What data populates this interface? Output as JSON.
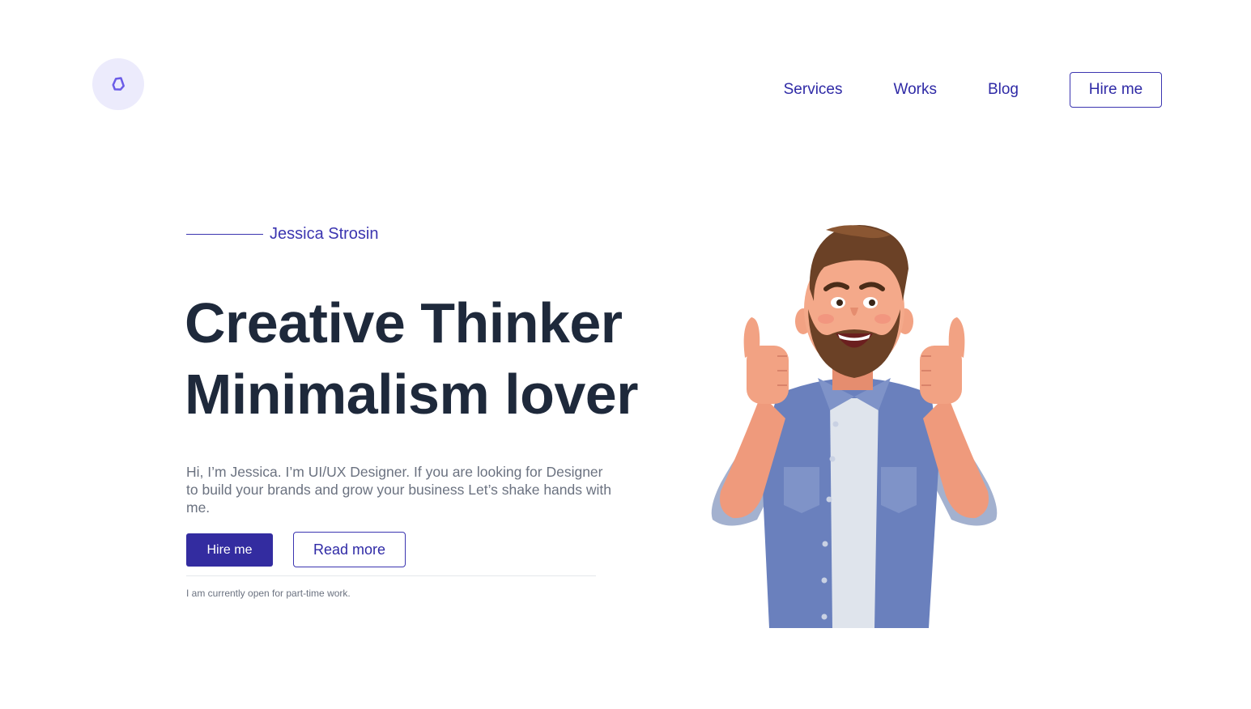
{
  "header": {
    "logo_icon": "droplet-logo-icon",
    "nav": {
      "items": [
        {
          "label": "Services"
        },
        {
          "label": "Works"
        },
        {
          "label": "Blog"
        }
      ],
      "hire_label": "Hire me"
    }
  },
  "hero": {
    "eyebrow": "Jessica Strosin",
    "headline_line1": "Creative Thinker",
    "headline_line2": "Minimalism lover",
    "intro": "Hi, I’m Jessica. I’m UI/UX Designer. If you are looking for Designer to build your brands and grow your business Let’s shake hands with me.",
    "primary_button": "Hire me",
    "secondary_button": "Read more",
    "availability": "I am currently open for part-time work.",
    "illustration": "thumbs-up-man-illustration"
  },
  "colors": {
    "accent": "#332ca0",
    "link": "#2f2aa6",
    "heading": "#1e293b",
    "body_text": "#6b7280",
    "logo_bg": "#ecebfc"
  }
}
